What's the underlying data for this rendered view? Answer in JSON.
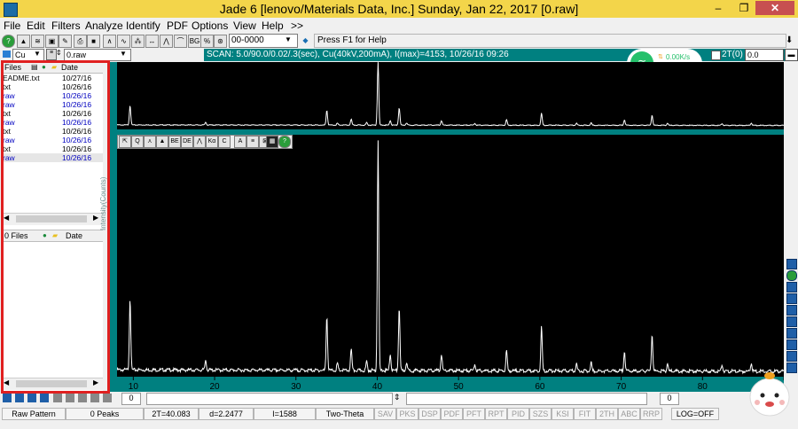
{
  "window": {
    "title": "Jade 6 [lenovo/Materials Data, Inc.] Sunday, Jan 22, 2017 [0.raw]",
    "minimize": "–",
    "maximize": "❐",
    "close": "✕"
  },
  "menu": [
    "File",
    "Edit",
    "Filters",
    "Analyze",
    "Identify",
    "PDF",
    "Options",
    "View",
    "Help",
    ">>"
  ],
  "toolbar": {
    "code_value": "00-0000",
    "hint": "Press F1 for Help",
    "anode": "Cu",
    "file": "0.raw"
  },
  "scan": {
    "info": "SCAN: 5.0/90.0/0.02/.3(sec), Cu(40kV,200mA), I(max)=4153, 10/26/16 09:26",
    "two_theta_label": "2T(0)",
    "two_theta_value": "0.0"
  },
  "network": {
    "speed": "0.00K/s",
    "count": "0"
  },
  "files_panel": {
    "headers": [
      "Files",
      "Date"
    ],
    "rows": [
      {
        "name": "EADME.txt",
        "date": "10/27/16",
        "color": "#000000"
      },
      {
        "name": "txt",
        "date": "10/26/16",
        "color": "#000000"
      },
      {
        "name": "raw",
        "date": "10/26/16",
        "color": "#0000c0"
      },
      {
        "name": "raw",
        "date": "10/26/16",
        "color": "#0000c0"
      },
      {
        "name": "txt",
        "date": "10/26/16",
        "color": "#000000"
      },
      {
        "name": "raw",
        "date": "10/26/16",
        "color": "#0000c0"
      },
      {
        "name": "txt",
        "date": "10/26/16",
        "color": "#000000"
      },
      {
        "name": "raw",
        "date": "10/26/16",
        "color": "#0000c0"
      },
      {
        "name": "txt",
        "date": "10/26/16",
        "color": "#000000"
      },
      {
        "name": "raw",
        "date": "10/26/16",
        "color": "#0000c0"
      }
    ],
    "lower_headers": [
      "0 Files",
      "Date"
    ]
  },
  "chart_data": {
    "type": "line",
    "ylabel": "Intensity(Counts)",
    "xlim": [
      8,
      90
    ],
    "ylim": [
      0,
      4200
    ],
    "x_ticks": [
      10,
      20,
      30,
      40,
      50,
      60,
      70,
      80,
      90
    ],
    "peaks": [
      {
        "x": 9.6,
        "y": 1300
      },
      {
        "x": 18.9,
        "y": 180
      },
      {
        "x": 33.8,
        "y": 980
      },
      {
        "x": 35.1,
        "y": 120
      },
      {
        "x": 36.8,
        "y": 380
      },
      {
        "x": 38.7,
        "y": 160
      },
      {
        "x": 40.1,
        "y": 4153
      },
      {
        "x": 41.6,
        "y": 300
      },
      {
        "x": 42.7,
        "y": 1150
      },
      {
        "x": 43.6,
        "y": 140
      },
      {
        "x": 47.9,
        "y": 300
      },
      {
        "x": 52.0,
        "y": 120
      },
      {
        "x": 55.9,
        "y": 360
      },
      {
        "x": 60.2,
        "y": 800
      },
      {
        "x": 64.5,
        "y": 130
      },
      {
        "x": 66.3,
        "y": 160
      },
      {
        "x": 70.4,
        "y": 360
      },
      {
        "x": 73.8,
        "y": 680
      },
      {
        "x": 75.7,
        "y": 140
      },
      {
        "x": 82.4,
        "y": 120
      },
      {
        "x": 86.0,
        "y": 150
      }
    ]
  },
  "bottom": {
    "fields": [
      "Raw Pattern",
      "0 Peaks",
      "2T=40.083",
      "d=2.2477",
      "I=1588",
      "Two-Theta"
    ],
    "tabs": [
      "SAV",
      "PKS",
      "DSP",
      "PDF",
      "PFT",
      "RPT",
      "PID",
      "SZS",
      "KSI",
      "FIT",
      "2TH",
      "ABC",
      "RRP"
    ],
    "log": "LOG=OFF",
    "zero": "0"
  }
}
